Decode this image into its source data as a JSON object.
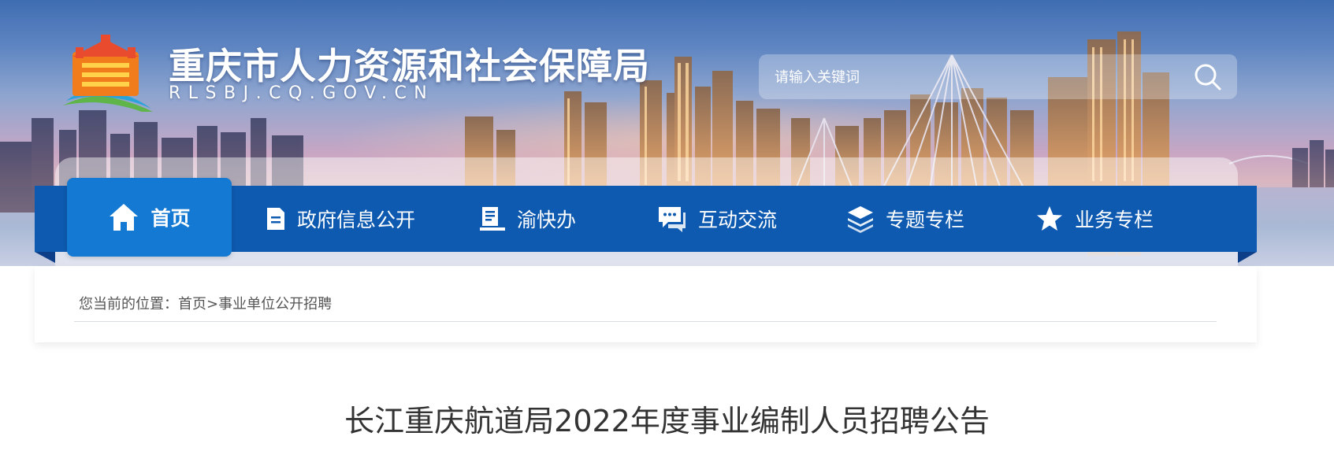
{
  "header": {
    "site_title": "重庆市人力资源和社会保障局",
    "site_domain": "RLSBJ.CQ.GOV.CN",
    "logo_icon": "chongqing-gate-logo"
  },
  "search": {
    "placeholder": "请输入关键词",
    "icon": "search-icon"
  },
  "nav": {
    "items": [
      {
        "label": "首页",
        "icon": "home-icon",
        "active": true
      },
      {
        "label": "政府信息公开",
        "icon": "document-icon",
        "active": false
      },
      {
        "label": "渝快办",
        "icon": "clipboard-icon",
        "active": false
      },
      {
        "label": "互动交流",
        "icon": "chat-icon",
        "active": false
      },
      {
        "label": "专题专栏",
        "icon": "layers-icon",
        "active": false
      },
      {
        "label": "业务专栏",
        "icon": "star-icon",
        "active": false
      }
    ]
  },
  "breadcrumb": {
    "prefix": "您当前的位置：",
    "home": "首页",
    "separator": ">",
    "current": "事业单位公开招聘"
  },
  "article": {
    "title": "长江重庆航道局2022年度事业编制人员招聘公告"
  },
  "colors": {
    "nav_bg": "#0e5ab0",
    "nav_active": "#1479d2",
    "title_text": "#333333"
  }
}
